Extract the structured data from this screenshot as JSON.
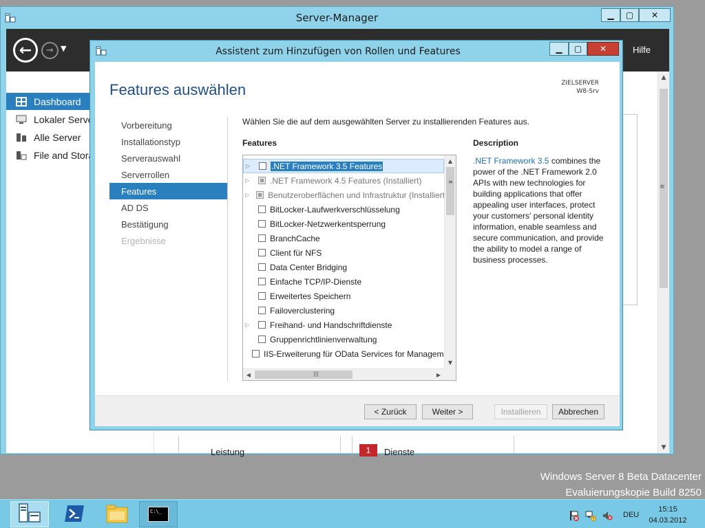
{
  "server_manager": {
    "title": "Server-Manager",
    "window_buttons": {
      "minimize": "▁",
      "maximize": "▢",
      "close": "✕"
    },
    "header": {
      "help_label": "Hilfe"
    },
    "sidebar": {
      "items": [
        {
          "label": "Dashboard",
          "icon": "dashboard-icon",
          "active": true
        },
        {
          "label": "Lokaler Server",
          "icon": "local-server-icon"
        },
        {
          "label": "Alle Server",
          "icon": "all-servers-icon"
        },
        {
          "label": "File and Storage Services",
          "icon": "storage-icon"
        }
      ]
    },
    "tiles": {
      "left_label": "Leistung",
      "right_badge": "1",
      "right_label": "Dienste"
    }
  },
  "wizard": {
    "title": "Assistent zum Hinzufügen von Rollen und Features",
    "heading": "Features auswählen",
    "target_server_label": "ZIELSERVER",
    "target_server_value": "W8-Srv",
    "steps": [
      {
        "label": "Vorbereitung",
        "state": "normal"
      },
      {
        "label": "Installationstyp",
        "state": "normal"
      },
      {
        "label": "Serverauswahl",
        "state": "normal"
      },
      {
        "label": "Serverrollen",
        "state": "normal"
      },
      {
        "label": "Features",
        "state": "active"
      },
      {
        "label": "AD DS",
        "state": "normal"
      },
      {
        "label": "Bestätigung",
        "state": "normal"
      },
      {
        "label": "Ergebnisse",
        "state": "disabled"
      }
    ],
    "instruction": "Wählen Sie die auf dem ausgewählten Server zu installierenden Features aus.",
    "features_label": "Features",
    "features": [
      {
        "label": ".NET Framework 3.5 Features",
        "expandable": true,
        "checked": false,
        "selected": true
      },
      {
        "label": ".NET Framework 4.5 Features (Installiert)",
        "expandable": true,
        "checked": true,
        "disabled": true
      },
      {
        "label": "Benutzeroberflächen und Infrastruktur (Installiert)",
        "expandable": true,
        "checked": true,
        "disabled": true
      },
      {
        "label": "BitLocker-Laufwerkverschlüsselung",
        "expandable": false,
        "checked": false
      },
      {
        "label": "BitLocker-Netzwerkentsperrung",
        "expandable": false,
        "checked": false
      },
      {
        "label": "BranchCache",
        "expandable": false,
        "checked": false
      },
      {
        "label": "Client für NFS",
        "expandable": false,
        "checked": false
      },
      {
        "label": "Data Center Bridging",
        "expandable": false,
        "checked": false
      },
      {
        "label": "Einfache TCP/IP-Dienste",
        "expandable": false,
        "checked": false
      },
      {
        "label": "Erweitertes Speichern",
        "expandable": false,
        "checked": false
      },
      {
        "label": "Failoverclustering",
        "expandable": false,
        "checked": false
      },
      {
        "label": "Freihand- und Handschriftdienste",
        "expandable": true,
        "checked": false
      },
      {
        "label": "Gruppenrichtlinienverwaltung",
        "expandable": false,
        "checked": false
      },
      {
        "label": "IIS-Erweiterung für OData Services for Management",
        "expandable": false,
        "checked": false
      }
    ],
    "description_label": "Description",
    "description_link": ".NET Framework 3.5",
    "description_text": " combines the power of the .NET Framework 2.0 APIs with new technologies for building applications that offer appealing user interfaces, protect your customers' personal identity information, enable seamless and secure communication, and provide the ability to model a range of business processes.",
    "buttons": {
      "back": "< Zurück",
      "next": "Weiter >",
      "install": "Installieren",
      "cancel": "Abbrechen"
    }
  },
  "desktop": {
    "watermark_line1": "Windows Server 8 Beta Datacenter",
    "watermark_line2": "Evaluierungskopie Build 8250"
  },
  "taskbar": {
    "items": [
      "server-manager-icon",
      "powershell-icon",
      "file-explorer-icon",
      "command-prompt-icon"
    ],
    "cmd_glyph": "C:\\_",
    "language": "DEU",
    "time": "15:15",
    "date": "04.03.2012"
  }
}
